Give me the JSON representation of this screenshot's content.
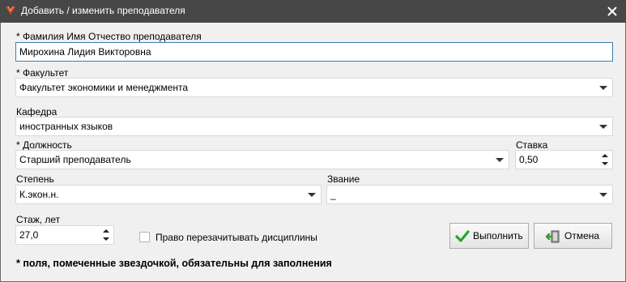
{
  "window": {
    "title": "Добавить / изменить преподавателя",
    "icon": "app-logo-icon",
    "close_icon": "close-icon"
  },
  "form": {
    "fio": {
      "label": "* Фамилия Имя Отчество преподавателя",
      "value": "Мирохина Лидия Викторовна"
    },
    "faculty": {
      "label": "* Факультет",
      "value": "Факультет экономики и менеджмента"
    },
    "department": {
      "label": "Кафедра",
      "value": "иностранных языков"
    },
    "position": {
      "label": "* Должность",
      "value": "Старший преподаватель"
    },
    "rate": {
      "label": "Ставка",
      "value": "0,50"
    },
    "degree": {
      "label": "Степень",
      "value": "К.экон.н."
    },
    "rank": {
      "label": "Звание",
      "value": "_"
    },
    "experience": {
      "label": "Стаж, лет",
      "value": "27,0"
    },
    "recount_checkbox": {
      "label": "Право перезачитывать дисциплины",
      "checked": false
    }
  },
  "buttons": {
    "execute": {
      "label": "Выполнить",
      "icon": "checkmark-icon",
      "icon_color": "#2aa52a"
    },
    "cancel": {
      "label": "Отмена",
      "icon": "exit-door-icon",
      "icon_color": "#3a9a3a"
    }
  },
  "note": "* поля, помеченные звездочкой, обязательны для заполнения",
  "colors": {
    "titlebar": "#474747",
    "dialog_bg": "#f0f0f0",
    "focus_border": "#3c7fb1"
  }
}
